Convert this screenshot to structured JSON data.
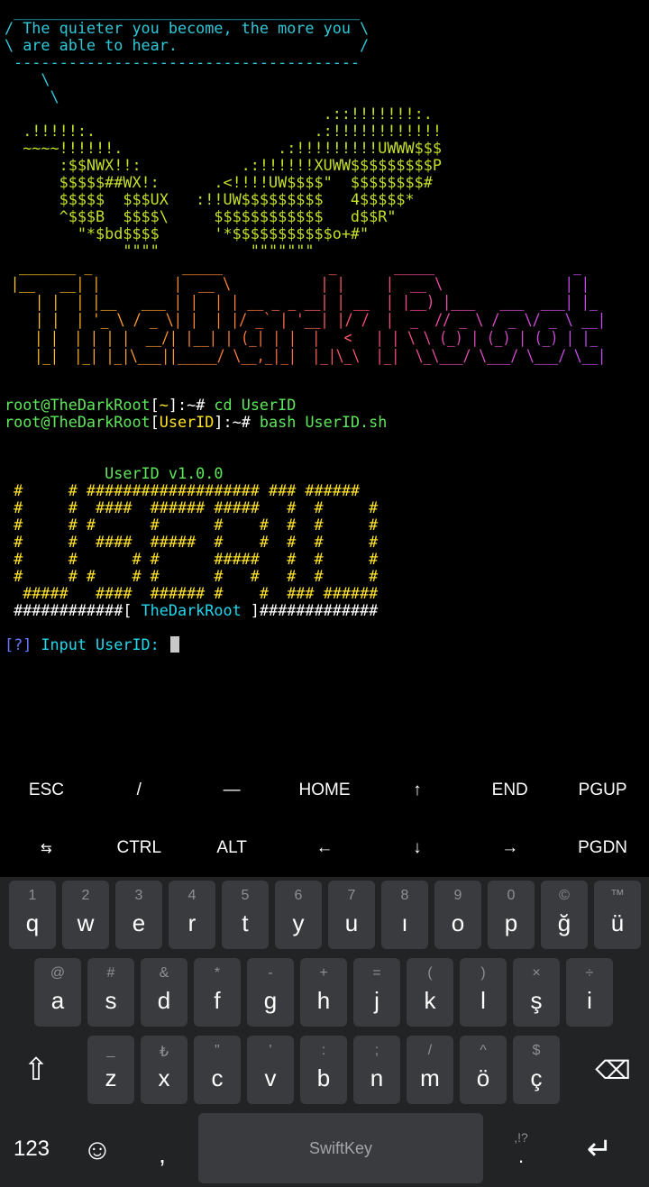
{
  "terminal": {
    "quote": {
      "top": " ______________________________________",
      "line1": "/ The quieter you become, the more you \\",
      "line2": "\\ are able to hear.                    /",
      "bottom": " --------------------------------------",
      "tail1": "    \\",
      "tail2": "     \\"
    },
    "hand_art": [
      "                                   .::!!!!!!!:.",
      "  .!!!!!:.                        .:!!!!!!!!!!!!",
      "  ~~~~!!!!!!.                 .:!!!!!!!!!UWWW$$$",
      "      :$$NWX!!:           .:!!!!!!XUWW$$$$$$$$$P",
      "      $$$$$##WX!:      .<!!!!UW$$$$\"  $$$$$$$$#",
      "      $$$$$  $$$UX   :!!UW$$$$$$$$$   4$$$$$*",
      "      ^$$$B  $$$$\\     $$$$$$$$$$$$   d$$R\"",
      "        \"*$bd$$$$      '*$$$$$$$$$$$o+#\"",
      "             \"\"\"\"          \"\"\"\"\"\"\""
    ],
    "banner_lines": [
      " _______ _           _____             _       _____                 _   ",
      "|__   __| |         |  __ \\           | |     |  __ \\               | |  ",
      "   | |  | |__   ___ | |  | | __ _ _ __| | __  | |__) |___   ___  ___| |_ ",
      "   | |  | '_ \\ / _ \\| |  | |/ _` | '__| |/ /  |  _  // _ \\ / _ \\/ _ \\ __|",
      "   | |  | | | |  __/| |__| | (_| | |  |   <   | | \\ \\ (_) | (_) | (_) | |_ ",
      "   |_|  |_| |_|\\___||_____/ \\__,_|_|  |_|\\_\\  |_|  \\_\\___/ \\___/ \\___/ \\__|"
    ],
    "banner_colors": [
      "#ffd11a",
      "#ff9f2a",
      "#ff7a3a",
      "#ff4f73",
      "#e14bc8",
      "#c44dff"
    ],
    "cmd1": {
      "user": "root@TheDarkRoot",
      "open": "[",
      "dir": "~",
      "close": "]",
      "suffix": ":~# ",
      "command": "cd UserID"
    },
    "cmd2": {
      "user": "root@TheDarkRoot",
      "open": "[",
      "dir": "UserID",
      "close": "]",
      "suffix": ":~# ",
      "command": "bash UserID.sh"
    },
    "tool_title": "           UserID v1.0.0",
    "id_art": [
      " #     # ################### ### ######",
      " #     #  ####  ###### #####   #  #     #",
      " #     # #      #      #    #  #  #     #",
      " #     #  ####  #####  #    #  #  #     #",
      " #     #      # #      #####   #  #     #",
      " #     # #    # #      #   #   #  #     #",
      "  #####   ####  ###### #    #  ### ######"
    ],
    "footer_left": " ############[ ",
    "footer_name": "TheDarkRoot",
    "footer_right": " ]#############",
    "input_tag": "[?]",
    "input_label": " Input UserID: "
  },
  "extra_keys": {
    "row1": [
      "ESC",
      "/",
      "—",
      "HOME",
      "↑",
      "END",
      "PGUP"
    ],
    "row2": [
      "⇆",
      "CTRL",
      "ALT",
      "←",
      "↓",
      "→",
      "PGDN"
    ]
  },
  "keyboard": {
    "row1": [
      {
        "hint": "1",
        "key": "q"
      },
      {
        "hint": "2",
        "key": "w"
      },
      {
        "hint": "3",
        "key": "e"
      },
      {
        "hint": "4",
        "key": "r"
      },
      {
        "hint": "5",
        "key": "t"
      },
      {
        "hint": "6",
        "key": "y"
      },
      {
        "hint": "7",
        "key": "u"
      },
      {
        "hint": "8",
        "key": "ı"
      },
      {
        "hint": "9",
        "key": "o"
      },
      {
        "hint": "0",
        "key": "p"
      },
      {
        "hint": "©",
        "key": "ğ"
      },
      {
        "hint": "™",
        "key": "ü"
      }
    ],
    "row2": [
      {
        "hint": "@",
        "key": "a"
      },
      {
        "hint": "#",
        "key": "s"
      },
      {
        "hint": "&",
        "key": "d"
      },
      {
        "hint": "*",
        "key": "f"
      },
      {
        "hint": "-",
        "key": "g"
      },
      {
        "hint": "+",
        "key": "h"
      },
      {
        "hint": "=",
        "key": "j"
      },
      {
        "hint": "(",
        "key": "k"
      },
      {
        "hint": ")",
        "key": "l"
      },
      {
        "hint": "×",
        "key": "ş"
      },
      {
        "hint": "÷",
        "key": "i"
      }
    ],
    "row3": [
      {
        "hint": "_",
        "key": "z"
      },
      {
        "hint": "₺",
        "key": "x"
      },
      {
        "hint": "\"",
        "key": "c"
      },
      {
        "hint": "'",
        "key": "v"
      },
      {
        "hint": ":",
        "key": "b"
      },
      {
        "hint": ";",
        "key": "n"
      },
      {
        "hint": "/",
        "key": "m"
      },
      {
        "hint": "^",
        "key": "ö"
      },
      {
        "hint": "$",
        "key": "ç"
      }
    ],
    "shift_icon": "⇧",
    "backspace_icon": "⌫",
    "numbers_label": "123",
    "emoji_icon": "☺",
    "comma": ",",
    "space_brand": "SwiftKey",
    "punct_hint": ",!?",
    "period": ".",
    "enter_icon": "↵"
  }
}
